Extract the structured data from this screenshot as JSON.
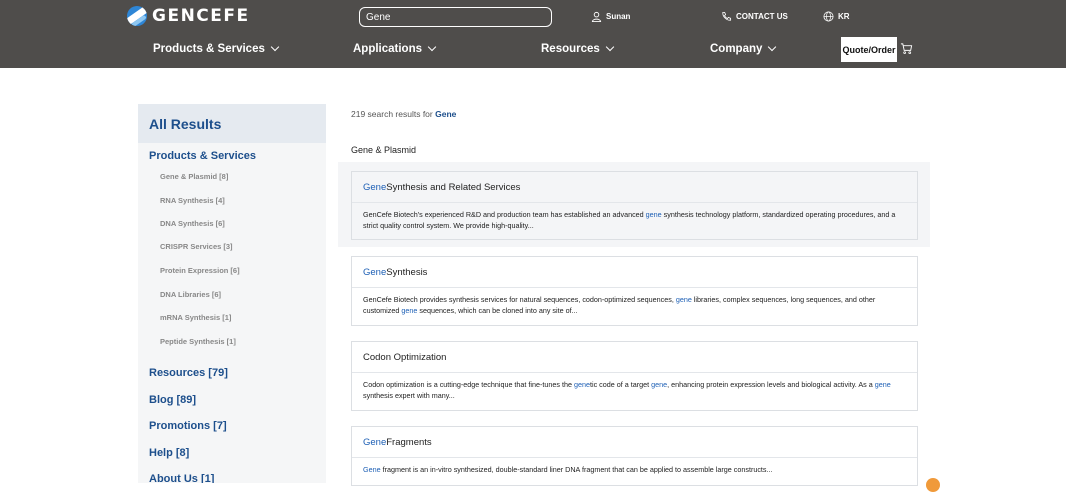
{
  "header": {
    "logo_text": "GENCEFE",
    "search_value": "Gene",
    "user_label": "Sunan",
    "contact_label": "CONTACT US",
    "lang_label": "KR",
    "nav": {
      "products": "Products & Services",
      "applications": "Applications",
      "resources": "Resources",
      "company": "Company"
    },
    "quote_label": "Quote/Order"
  },
  "sidebar": {
    "title": "All Results",
    "products_label": "Products & Services",
    "subitems": [
      "Gene & Plasmid [8]",
      "RNA Synthesis [4]",
      "DNA Synthesis [6]",
      "CRISPR Services [3]",
      "Protein Expression [6]",
      "DNA Libraries [6]",
      "mRNA Synthesis [1]",
      "Peptide Synthesis [1]"
    ],
    "categories": [
      "Resources [79]",
      "Blog [89]",
      "Promotions [7]",
      "Help [8]",
      "About Us [1]"
    ]
  },
  "main": {
    "count_prefix": "219 search results for ",
    "count_term": "Gene",
    "group_title": "Gene & Plasmid",
    "cards": [
      {
        "title_hl": "Gene",
        "title_rest": " Synthesis and Related Services",
        "body": [
          [
            "GenCefe Biotech's experienced R&D and production team has established an advanced ",
            false
          ],
          [
            "gene",
            true
          ],
          [
            " synthesis technology platform, standardized operating procedures, and a strict quality control system. We provide high-quality...",
            false
          ]
        ]
      },
      {
        "title_hl": "Gene",
        "title_rest": " Synthesis",
        "body": [
          [
            "GenCefe Biotech provides synthesis services for natural sequences, codon-optimized sequences, ",
            false
          ],
          [
            "gene",
            true
          ],
          [
            " libraries, complex sequences, long sequences, and other customized ",
            false
          ],
          [
            "gene",
            true
          ],
          [
            " sequences, which can be cloned into any site of...",
            false
          ]
        ]
      },
      {
        "title_hl": "",
        "title_rest": "Codon Optimization",
        "body": [
          [
            "Codon optimization is a cutting-edge technique that fine-tunes the ",
            false
          ],
          [
            "gene",
            true
          ],
          [
            "tic code of a target ",
            false
          ],
          [
            "gene",
            true
          ],
          [
            ", enhancing protein expression levels and biological activity. As a ",
            false
          ],
          [
            "gene",
            true
          ],
          [
            " synthesis expert with many...",
            false
          ]
        ]
      },
      {
        "title_hl": "Gene",
        "title_rest": " Fragments",
        "body": [
          [
            "Gene",
            true
          ],
          [
            " fragment is an in-vitro synthesized, double-standard liner DNA fragment that can be applied to assemble large constructs...",
            false
          ]
        ]
      }
    ]
  },
  "colors": {
    "header_bg": "#4f4d4b",
    "accent": "#1d4f8c",
    "highlight": "#1d5fb5"
  }
}
